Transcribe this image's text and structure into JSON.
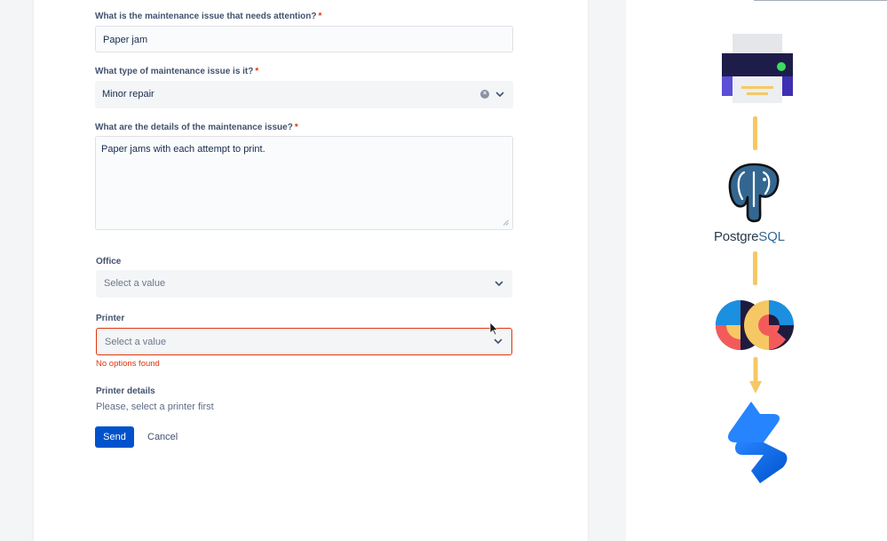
{
  "form": {
    "q1_label": "What is the maintenance issue that needs attention?",
    "q1_value": "Paper jam",
    "q2_label": "What type of maintenance issue is it?",
    "q2_value": "Minor repair",
    "q3_label": "What are the details of the maintenance issue?",
    "q3_value": "Paper jams with each attempt to print.",
    "required_mark": "*",
    "office_label": "Office",
    "office_placeholder": "Select a value",
    "printer_label": "Printer",
    "printer_placeholder": "Select a value",
    "printer_error": "No options found",
    "printer_details_label": "Printer details",
    "printer_details_hint": "Please, select a printer first",
    "send_label": "Send",
    "cancel_label": "Cancel"
  },
  "diagram": {
    "postgres_prefix": "Postgre",
    "postgres_suffix": "SQL",
    "icons": [
      "printer-icon",
      "postgresql-icon",
      "integration-logo-icon",
      "jira-service-management-icon"
    ]
  },
  "colors": {
    "primary": "#0052cc",
    "error": "#de350b",
    "connector": "#f6c864"
  }
}
